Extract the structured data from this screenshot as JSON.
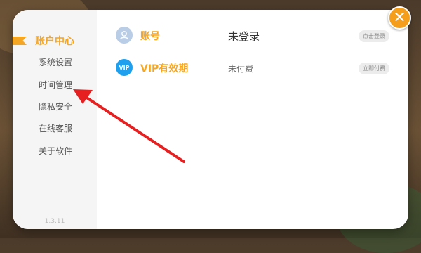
{
  "sidebar": {
    "items": [
      {
        "label": "账户中心",
        "active": true
      },
      {
        "label": "系统设置"
      },
      {
        "label": "时间管理"
      },
      {
        "label": "隐私安全"
      },
      {
        "label": "在线客服"
      },
      {
        "label": "关于软件"
      }
    ],
    "version": "1.3.11"
  },
  "account": {
    "label": "账号",
    "value": "未登录",
    "button": "点击登录"
  },
  "vip": {
    "icon_text": "VIP",
    "label": "VIP有效期",
    "value": "未付费",
    "button": "立即付费"
  },
  "close_icon": "close-icon",
  "colors": {
    "accent": "#f5a623",
    "arrow": "#e62020",
    "vip_badge": "#1ea0ee"
  }
}
